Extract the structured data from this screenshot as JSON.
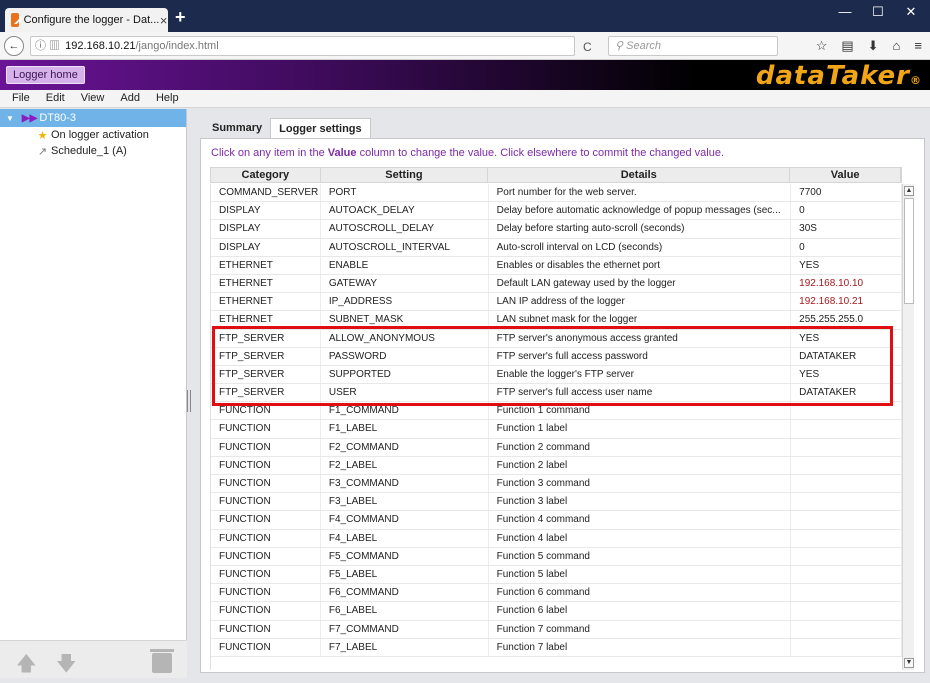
{
  "browser": {
    "tab_title": "Configure the logger - Dat...",
    "tab_close": "×",
    "new_tab": "+",
    "window_controls": [
      "—",
      "☐",
      "✕"
    ],
    "url_host": "192.168.10.21",
    "url_path": "/jango/index.html",
    "search_placeholder": "Search",
    "back_label": "←",
    "reload_label": "C"
  },
  "header": {
    "home_button": "Logger home",
    "logo": "dataTaker",
    "logo_suffix": "®"
  },
  "menu": [
    "File",
    "Edit",
    "View",
    "Add",
    "Help"
  ],
  "sidebar": {
    "root": "DT80-3",
    "children": [
      {
        "label": "On logger activation",
        "icon": "star-icon"
      },
      {
        "label": "Schedule_1 (A)",
        "icon": "schedule-icon"
      }
    ]
  },
  "tabs": [
    "Summary",
    "Logger settings"
  ],
  "instruction": {
    "pre": "Click on any item in the ",
    "bold": "Value",
    "post": " column to change the value.  Click elsewhere to commit the changed value."
  },
  "table": {
    "headers": [
      "Category",
      "Setting",
      "Details",
      "Value"
    ],
    "rows": [
      [
        "COMMAND_SERVER",
        "PORT",
        "Port number for the web server.",
        "7700"
      ],
      [
        "DISPLAY",
        "AUTOACK_DELAY",
        "Delay before automatic acknowledge of popup messages (sec...",
        "0"
      ],
      [
        "DISPLAY",
        "AUTOSCROLL_DELAY",
        "Delay before starting auto-scroll (seconds)",
        "30S"
      ],
      [
        "DISPLAY",
        "AUTOSCROLL_INTERVAL",
        "Auto-scroll interval on LCD (seconds)",
        "0"
      ],
      [
        "ETHERNET",
        "ENABLE",
        "Enables or disables the ethernet port",
        "YES"
      ],
      [
        "ETHERNET",
        "GATEWAY",
        "Default LAN gateway used by the logger",
        "192.168.10.10"
      ],
      [
        "ETHERNET",
        "IP_ADDRESS",
        "LAN IP address of the logger",
        "192.168.10.21"
      ],
      [
        "ETHERNET",
        "SUBNET_MASK",
        "LAN subnet mask for the logger",
        "255.255.255.0"
      ],
      [
        "FTP_SERVER",
        "ALLOW_ANONYMOUS",
        "FTP server's anonymous access granted",
        "YES"
      ],
      [
        "FTP_SERVER",
        "PASSWORD",
        "FTP server's full access password",
        "DATATAKER"
      ],
      [
        "FTP_SERVER",
        "SUPPORTED",
        "Enable the logger's FTP server",
        "YES"
      ],
      [
        "FTP_SERVER",
        "USER",
        "FTP server's full access user name",
        "DATATAKER"
      ],
      [
        "FUNCTION",
        "F1_COMMAND",
        "Function 1 command",
        ""
      ],
      [
        "FUNCTION",
        "F1_LABEL",
        "Function 1 label",
        ""
      ],
      [
        "FUNCTION",
        "F2_COMMAND",
        "Function 2 command",
        ""
      ],
      [
        "FUNCTION",
        "F2_LABEL",
        "Function 2 label",
        ""
      ],
      [
        "FUNCTION",
        "F3_COMMAND",
        "Function 3 command",
        ""
      ],
      [
        "FUNCTION",
        "F3_LABEL",
        "Function 3 label",
        ""
      ],
      [
        "FUNCTION",
        "F4_COMMAND",
        "Function 4 command",
        ""
      ],
      [
        "FUNCTION",
        "F4_LABEL",
        "Function 4 label",
        ""
      ],
      [
        "FUNCTION",
        "F5_COMMAND",
        "Function 5 command",
        ""
      ],
      [
        "FUNCTION",
        "F5_LABEL",
        "Function 5 label",
        ""
      ],
      [
        "FUNCTION",
        "F6_COMMAND",
        "Function 6 command",
        ""
      ],
      [
        "FUNCTION",
        "F6_LABEL",
        "Function 6 label",
        ""
      ],
      [
        "FUNCTION",
        "F7_COMMAND",
        "Function 7 command",
        ""
      ],
      [
        "FUNCTION",
        "F7_LABEL",
        "Function 7 label",
        ""
      ]
    ],
    "red_values": [
      "192.168.10.10",
      "192.168.10.21"
    ]
  },
  "colors": {
    "accent": "#7d2aa6",
    "highlight_box": "#e00e12",
    "logo": "#f2a516",
    "selection": "#6fb3e8"
  }
}
